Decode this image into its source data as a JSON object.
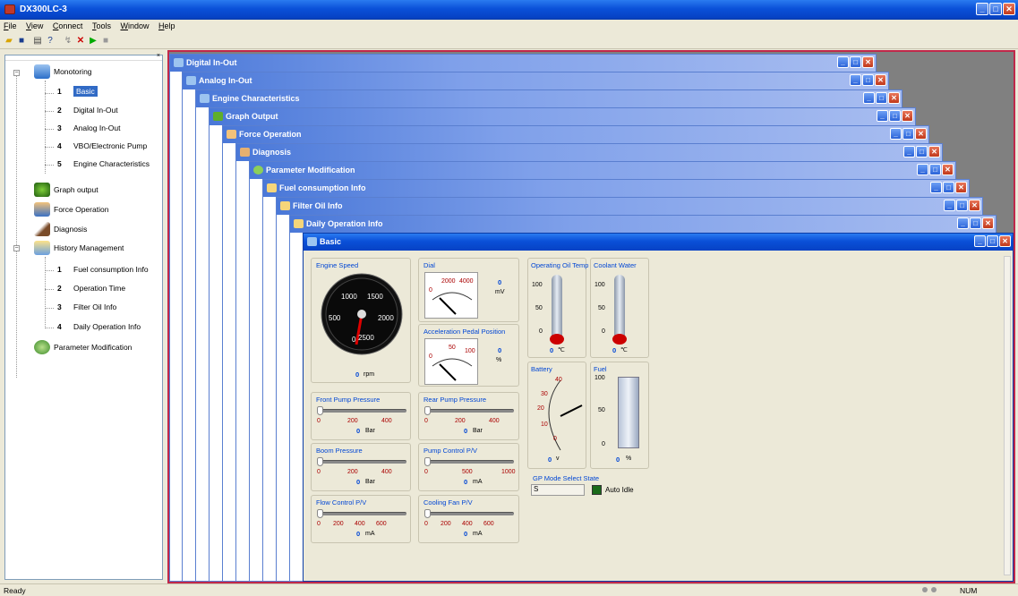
{
  "app": {
    "title": "DX300LC-3"
  },
  "menu": [
    "File",
    "View",
    "Connect",
    "Tools",
    "Window",
    "Help"
  ],
  "tree": {
    "monitoring": "Monotoring",
    "monitoring_items": [
      {
        "num": "1",
        "label": "Basic"
      },
      {
        "num": "2",
        "label": "Digital In-Out"
      },
      {
        "num": "3",
        "label": "Analog In-Out"
      },
      {
        "num": "4",
        "label": "VBO/Electronic Pump"
      },
      {
        "num": "5",
        "label": "Engine Characteristics"
      }
    ],
    "graph_output": "Graph output",
    "force_operation": "Force Operation",
    "diagnosis": "Diagnosis",
    "history": "History Management",
    "history_items": [
      {
        "num": "1",
        "label": "Fuel consumption Info"
      },
      {
        "num": "2",
        "label": "Operation Time"
      },
      {
        "num": "3",
        "label": "Filter Oil Info"
      },
      {
        "num": "4",
        "label": "Daily Operation Info"
      }
    ],
    "parameter": "Parameter Modification"
  },
  "windows": [
    "Digital In-Out",
    "Analog In-Out",
    "Engine Characteristics",
    "Graph Output",
    "Force Operation",
    "Diagnosis",
    "Parameter Modification",
    "Fuel consumption Info",
    "Filter Oil Info",
    "Daily Operation Info"
  ],
  "basic": {
    "title": "Basic",
    "engine_speed": {
      "label": "Engine Speed",
      "value": "0",
      "unit": "rpm",
      "dial_ticks": [
        "1000",
        "1500",
        "500",
        "2000",
        "0",
        "2500"
      ],
      "needle_value": 0
    },
    "dial": {
      "label": "Dial",
      "value": "0",
      "unit": "mV",
      "ticks": [
        "2000",
        "4000",
        "0"
      ]
    },
    "accel": {
      "label": "Acceleration Pedal Position",
      "value": "0",
      "unit": "%",
      "ticks": [
        "50",
        "100",
        "0"
      ]
    },
    "oil_temp": {
      "label": "Operating Oil Temp",
      "value": "0",
      "unit": "℃",
      "ticks": [
        "100",
        "50",
        "0"
      ]
    },
    "coolant": {
      "label": "Coolant Water",
      "value": "0",
      "unit": "℃",
      "ticks": [
        "100",
        "50",
        "0"
      ]
    },
    "battery": {
      "label": "Battery",
      "value": "0",
      "unit": "v",
      "ticks": [
        "40",
        "30",
        "20",
        "10",
        "0"
      ]
    },
    "fuel": {
      "label": "Fuel",
      "value": "0",
      "unit": "%",
      "ticks": [
        "100",
        "50",
        "0"
      ]
    },
    "front_pump": {
      "label": "Front Pump Pressure",
      "value": "0",
      "unit": "Bar",
      "ticks": [
        "0",
        "200",
        "400"
      ]
    },
    "rear_pump": {
      "label": "Rear Pump Pressure",
      "value": "0",
      "unit": "Bar",
      "ticks": [
        "0",
        "200",
        "400"
      ]
    },
    "boom": {
      "label": "Boom Pressure",
      "value": "0",
      "unit": "Bar",
      "ticks": [
        "0",
        "200",
        "400"
      ]
    },
    "pump_ctrl": {
      "label": "Pump Control P/V",
      "value": "0",
      "unit": "mA",
      "ticks": [
        "0",
        "500",
        "1000"
      ]
    },
    "flow_ctrl": {
      "label": "Flow Control P/V",
      "value": "0",
      "unit": "mA",
      "ticks": [
        "0",
        "200",
        "400",
        "600"
      ]
    },
    "fan": {
      "label": "Cooling Fan P/V",
      "value": "0",
      "unit": "mA",
      "ticks": [
        "0",
        "200",
        "400",
        "600"
      ]
    },
    "gp_mode": {
      "label": "GP Mode Select State",
      "value": "S",
      "auto_idle": "Auto Idle"
    }
  },
  "status": {
    "left": "Ready",
    "right": "NUM"
  },
  "colors": {
    "title_blue": "#0a50d8",
    "mdi_border": "#c0284a",
    "label_blue": "#0046d5"
  }
}
